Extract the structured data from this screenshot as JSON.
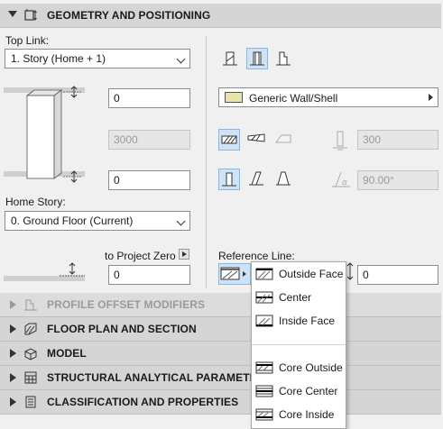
{
  "sections": {
    "geometry": "GEOMETRY AND POSITIONING",
    "profile": "PROFILE OFFSET MODIFIERS",
    "floorplan": "FLOOR PLAN AND SECTION",
    "model": "MODEL",
    "structural": "STRUCTURAL ANALYTICAL PARAMETERS",
    "classification": "CLASSIFICATION AND PROPERTIES"
  },
  "left": {
    "top_link_label": "Top Link:",
    "top_link_value": "1. Story (Home + 1)",
    "top_offset": "0",
    "height": "3000",
    "bottom_offset": "0",
    "home_story_label": "Home Story:",
    "home_story_value": "0. Ground Floor (Current)",
    "to_project_zero_label": "to Project Zero",
    "project_zero_value": "0"
  },
  "right": {
    "surface_name": "Generic Wall/Shell",
    "thickness": "300",
    "angle": "90.00°",
    "reference_line_label": "Reference Line:",
    "reference_offset": "0"
  },
  "reference_menu": {
    "items": [
      "Outside Face",
      "Center",
      "Inside Face",
      "Core Outside",
      "Core Center",
      "Core Inside"
    ]
  },
  "colors": {
    "header_bg": "#d5d5d5",
    "active_button": "#cfe3f7",
    "surface_swatch": "#e8e3a8"
  }
}
